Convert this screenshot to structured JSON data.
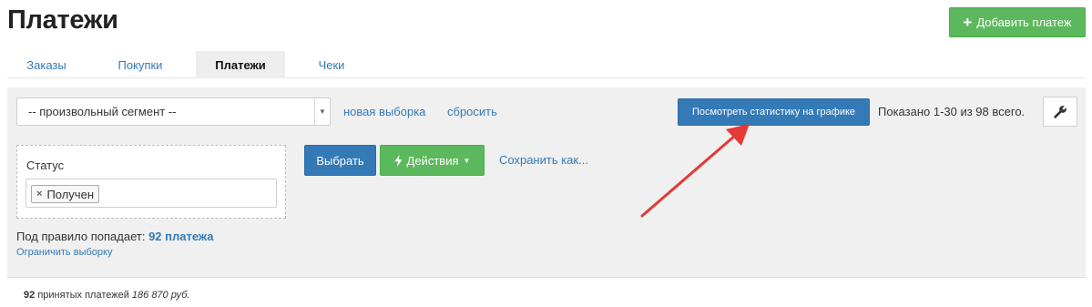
{
  "header": {
    "title": "Платежи",
    "add_button": "Добавить платеж"
  },
  "tabs": [
    {
      "label": "Заказы"
    },
    {
      "label": "Покупки"
    },
    {
      "label": "Платежи"
    },
    {
      "label": "Чеки"
    }
  ],
  "toolbar": {
    "segment_select": "-- произвольный сегмент --",
    "new_selection": "новая выборка",
    "reset": "сбросить",
    "stats_button": "Посмотреть статистику на графике",
    "shown_text": "Показано 1-30 из 98 всего."
  },
  "filter": {
    "status_label": "Статус",
    "status_chip": "Получен",
    "choose_button": "Выбрать",
    "actions_button": "Действия",
    "save_as": "Сохранить как..."
  },
  "rule": {
    "prefix": "Под правило попадает:",
    "count": "92 платежа",
    "limit_link": "Ограничить выборку"
  },
  "summary": {
    "count": "92",
    "label": "принятых платежей",
    "amount": "186 870 руб."
  },
  "colors": {
    "primary": "#337ab7",
    "success": "#5cb85c",
    "annotation": "#e53935"
  },
  "icons": {
    "add": "plus-icon",
    "wrench": "wrench-icon",
    "bolt": "lightning-icon",
    "remove_chip": "close-icon"
  }
}
